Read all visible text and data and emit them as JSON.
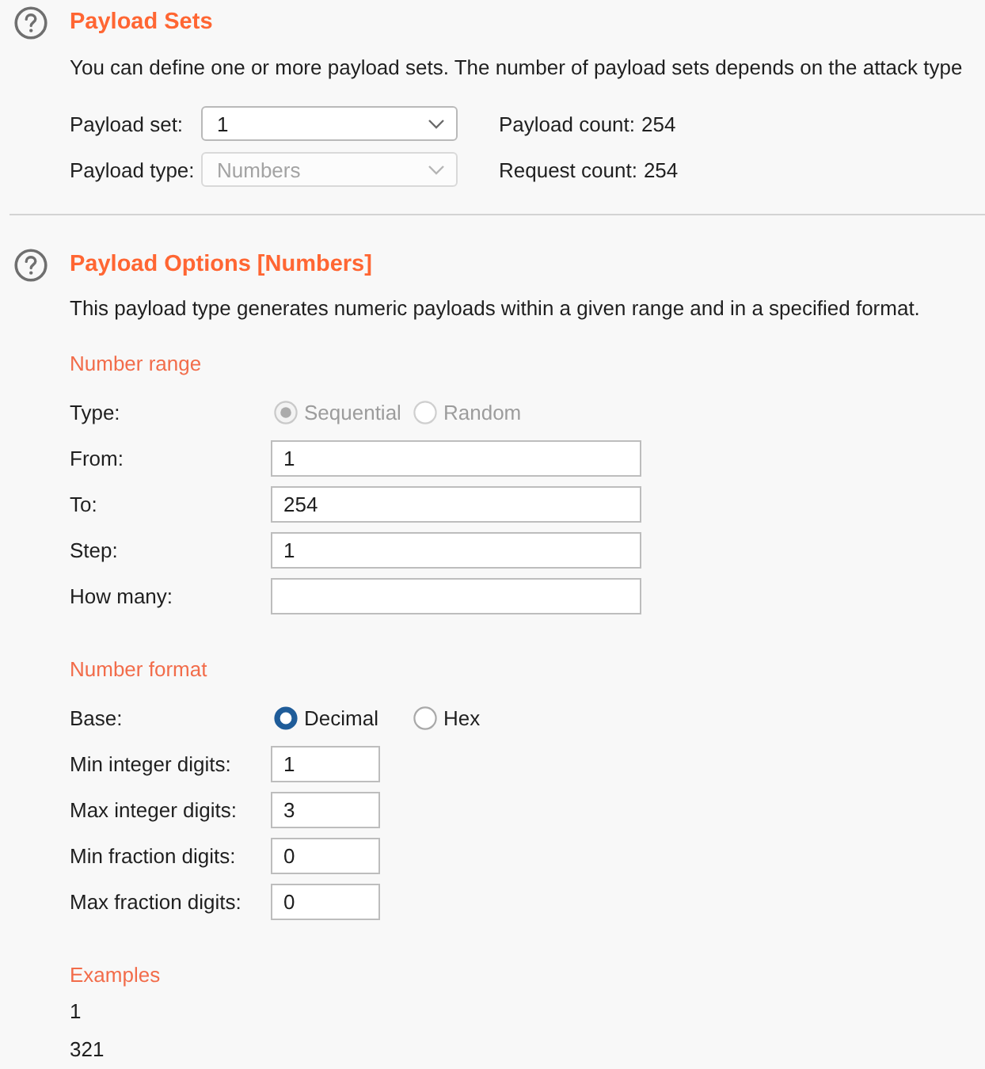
{
  "payload_sets": {
    "title": "Payload Sets",
    "description": "You can define one or more payload sets. The number of payload sets depends on the attack type",
    "rows": [
      {
        "label": "Payload set:",
        "value": "1",
        "disabled": false,
        "count_label": "Payload count:",
        "count": "254"
      },
      {
        "label": "Payload type:",
        "value": "Numbers",
        "disabled": true,
        "count_label": "Request count:",
        "count": "254"
      }
    ]
  },
  "payload_options": {
    "title": "Payload Options [Numbers]",
    "description": "This payload type generates numeric payloads within a given range and in a specified format.",
    "groups": [
      {
        "heading": "Number range",
        "items": [
          {
            "kind": "radio",
            "label": "Type:",
            "disabled": true,
            "options": [
              {
                "label": "Sequential",
                "selected": true
              },
              {
                "label": "Random",
                "selected": false
              }
            ]
          },
          {
            "kind": "field",
            "label": "From:",
            "value": "1"
          },
          {
            "kind": "field",
            "label": "To:",
            "value": "254"
          },
          {
            "kind": "field",
            "label": "Step:",
            "value": "1"
          },
          {
            "kind": "field",
            "label": "How many:"
          }
        ]
      },
      {
        "heading": "Number format",
        "items": [
          {
            "kind": "radio",
            "label": "Base:",
            "disabled": false,
            "options": [
              {
                "label": "Decimal",
                "selected": true
              },
              {
                "label": "Hex",
                "selected": false
              }
            ]
          },
          {
            "kind": "short_field",
            "label": "Min integer digits:",
            "value": "1"
          },
          {
            "kind": "short_field",
            "label": "Max integer digits:",
            "value": "3"
          },
          {
            "kind": "short_field",
            "label": "Min fraction digits:",
            "value": "0"
          },
          {
            "kind": "short_field",
            "label": "Max fraction digits:",
            "value": "0"
          }
        ]
      },
      {
        "heading": "Examples",
        "items": [
          {
            "kind": "example",
            "text": "1"
          },
          {
            "kind": "example",
            "text": "321"
          }
        ]
      }
    ]
  }
}
